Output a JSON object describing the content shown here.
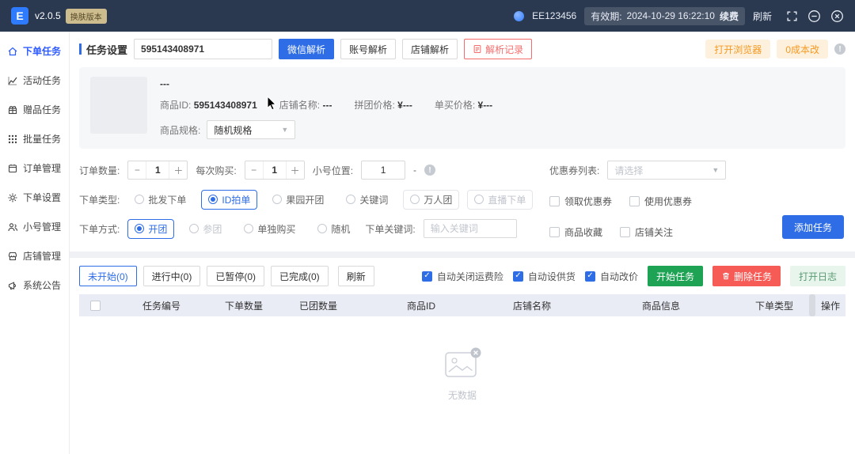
{
  "topbar": {
    "logo": "E",
    "version": "v2.0.5",
    "badge": "换肤版本",
    "account": "EE123456",
    "validity_label": "有效期:",
    "validity_value": "2024-10-29 16:22:10",
    "renew": "续费",
    "refresh": "刷新"
  },
  "sidebar": {
    "items": [
      {
        "label": "下单任务",
        "active": true
      },
      {
        "label": "活动任务",
        "active": false
      },
      {
        "label": "赠品任务",
        "active": false
      },
      {
        "label": "批量任务",
        "active": false
      },
      {
        "label": "订单管理",
        "active": false
      },
      {
        "label": "下单设置",
        "active": false
      },
      {
        "label": "小号管理",
        "active": false
      },
      {
        "label": "店铺管理",
        "active": false
      },
      {
        "label": "系统公告",
        "active": false
      }
    ]
  },
  "task_setup": {
    "label": "任务设置",
    "input_value": "595143408971",
    "wechat_parse": "微信解析",
    "account_parse": "账号解析",
    "shop_parse": "店铺解析",
    "parse_record": "解析记录",
    "open_browser": "打开浏览器",
    "zero_cost": "0成本改"
  },
  "product": {
    "title": "---",
    "id_label": "商品ID:",
    "id_value": "595143408971",
    "shop_label": "店铺名称:",
    "shop_value": "---",
    "group_price_label": "拼团价格:",
    "group_price": "¥---",
    "single_price_label": "单买价格:",
    "single_price": "¥---",
    "spec_label": "商品规格:",
    "spec_value": "随机规格"
  },
  "options": {
    "order_qty_label": "订单数量:",
    "order_qty": "1",
    "per_buy_label": "每次购买:",
    "per_buy": "1",
    "position_label": "小号位置:",
    "position": "1",
    "position_suffix": "-",
    "coupon_list_label": "优惠券列表:",
    "coupon_placeholder": "请选择",
    "order_type_label": "下单类型:",
    "order_types": [
      {
        "label": "批发下单",
        "state": "normal"
      },
      {
        "label": "ID拍单",
        "state": "selected"
      },
      {
        "label": "果园开团",
        "state": "normal"
      },
      {
        "label": "关键词",
        "state": "normal"
      },
      {
        "label": "万人团",
        "state": "normal"
      },
      {
        "label": "直播下单",
        "state": "disabled"
      }
    ],
    "get_coupon": "领取优惠券",
    "use_coupon": "使用优惠券",
    "order_mode_label": "下单方式:",
    "order_modes": [
      {
        "label": "开团",
        "state": "selected"
      },
      {
        "label": "参团",
        "state": "disabled"
      },
      {
        "label": "单独购买",
        "state": "normal"
      },
      {
        "label": "随机",
        "state": "normal"
      }
    ],
    "keyword_label": "下单关键词:",
    "keyword_placeholder": "输入关键词",
    "favorite_product": "商品收藏",
    "follow_shop": "店铺关注",
    "add_task": "添加任务"
  },
  "tasks": {
    "tabs": [
      {
        "label": "未开始(0)",
        "active": true
      },
      {
        "label": "进行中(0)",
        "active": false
      },
      {
        "label": "已暂停(0)",
        "active": false
      },
      {
        "label": "已完成(0)",
        "active": false
      }
    ],
    "refresh": "刷新",
    "auto_checkboxes": [
      "自动关闭运费险",
      "自动设供货",
      "自动改价"
    ],
    "start": "开始任务",
    "delete": "删除任务",
    "open_log": "打开日志",
    "columns": [
      "任务编号",
      "下单数量",
      "已团数量",
      "商品ID",
      "店铺名称",
      "商品信息",
      "下单类型",
      "操作"
    ],
    "empty": "无数据"
  },
  "colors": {
    "accent": "#2e6de6",
    "topbar": "#2a3950",
    "green": "#1ea355",
    "red": "#f65b56",
    "orange": "#f59a23",
    "table_header": "#e9ebf5"
  }
}
